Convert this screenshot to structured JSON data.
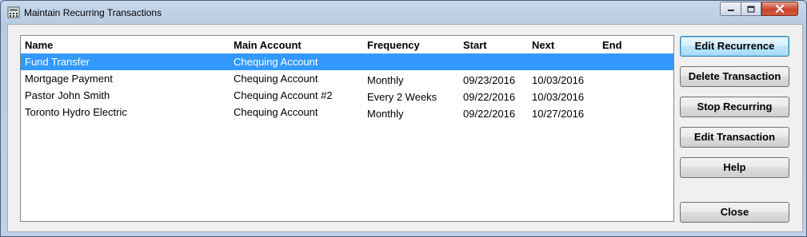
{
  "window": {
    "title": "Maintain Recurring Transactions"
  },
  "table": {
    "columns": [
      "Name",
      "Main Account",
      "Frequency",
      "Start",
      "Next",
      "End"
    ],
    "rows": [
      {
        "name": "Fund Transfer",
        "account": "Chequing Account",
        "frequency": "",
        "start": "",
        "next": "",
        "end": "",
        "selected": true
      },
      {
        "name": "Mortgage Payment",
        "account": "Chequing Account",
        "frequency": "Monthly",
        "start": "09/23/2016",
        "next": "10/03/2016",
        "end": ""
      },
      {
        "name": "Pastor John Smith",
        "account": "Chequing Account #2",
        "frequency": "Every 2 Weeks",
        "start": "09/22/2016",
        "next": "10/03/2016",
        "end": ""
      },
      {
        "name": "Toronto Hydro Electric",
        "account": "Chequing Account",
        "frequency": "Monthly",
        "start": "09/22/2016",
        "next": "10/27/2016",
        "end": ""
      }
    ]
  },
  "buttons": {
    "edit_recurrence": "Edit Recurrence",
    "delete_transaction": "Delete Transaction",
    "stop_recurring": "Stop Recurring",
    "edit_transaction": "Edit Transaction",
    "help": "Help",
    "close": "Close"
  },
  "colors": {
    "selection": "#3399ff",
    "close_button": "#c7452a"
  }
}
